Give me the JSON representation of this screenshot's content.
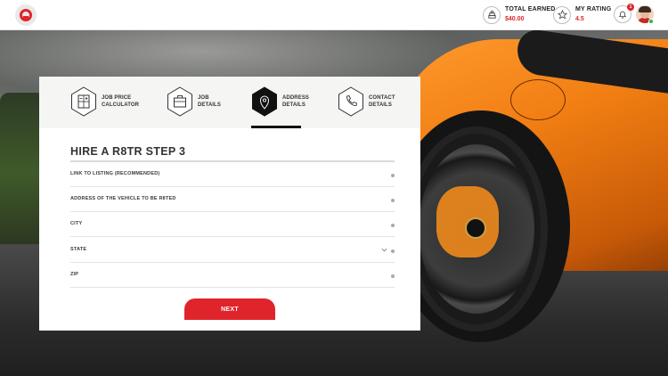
{
  "header": {
    "logo_icon": "r8-logo-icon",
    "total_earned": {
      "label": "TOTAL EARNED",
      "value": "$40.00",
      "icon": "money-stack-icon"
    },
    "my_rating": {
      "label": "MY RATING",
      "value": "4.5",
      "icon": "star-icon"
    },
    "notifications": {
      "icon": "bell-icon",
      "count": "1"
    },
    "avatar": {
      "status": "online"
    }
  },
  "wizard": {
    "steps": [
      {
        "line1": "JOB PRICE",
        "line2": "CALCULATOR",
        "icon": "calculator-icon",
        "active": false
      },
      {
        "line1": "JOB",
        "line2": "DETAILS",
        "icon": "briefcase-icon",
        "active": false
      },
      {
        "line1": "ADDRESS",
        "line2": "DETAILS",
        "icon": "location-pin-icon",
        "active": true
      },
      {
        "line1": "CONTACT",
        "line2": "DETAILS",
        "icon": "phone-icon",
        "active": false
      }
    ],
    "title": "HIRE A R8TR STEP 3",
    "fields": [
      {
        "label": "LINK TO LISTING (RECOMMENDED)"
      },
      {
        "label": "ADDRESS OF THE VEHICLE TO BE R8TED"
      },
      {
        "label": "CITY"
      },
      {
        "label": "STATE",
        "type": "select"
      },
      {
        "label": "ZIP"
      }
    ],
    "next_label": "NEXT"
  },
  "colors": {
    "accent": "#e0242b",
    "active_step": "#111111"
  }
}
